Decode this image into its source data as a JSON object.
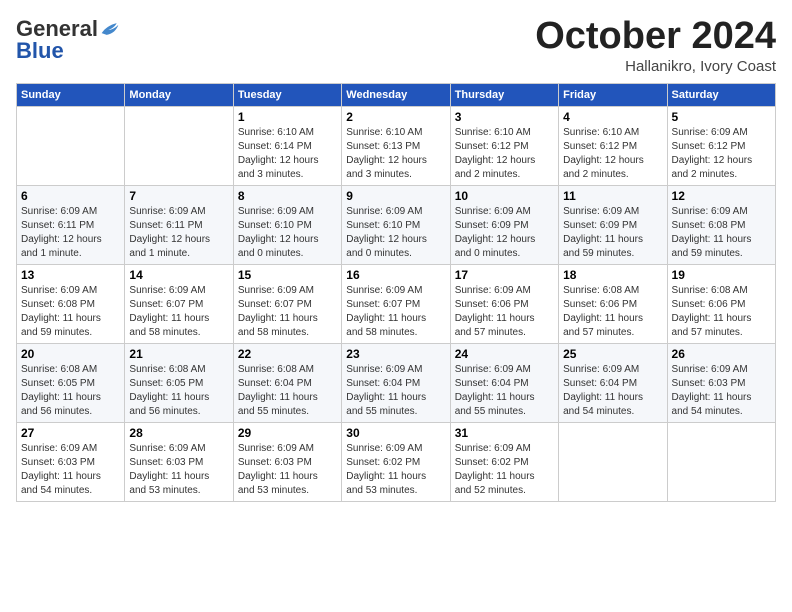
{
  "logo": {
    "general": "General",
    "blue": "Blue"
  },
  "header": {
    "month": "October 2024",
    "location": "Hallanikro, Ivory Coast"
  },
  "weekdays": [
    "Sunday",
    "Monday",
    "Tuesday",
    "Wednesday",
    "Thursday",
    "Friday",
    "Saturday"
  ],
  "weeks": [
    [
      {
        "day": "",
        "info": ""
      },
      {
        "day": "",
        "info": ""
      },
      {
        "day": "1",
        "info": "Sunrise: 6:10 AM\nSunset: 6:14 PM\nDaylight: 12 hours\nand 3 minutes."
      },
      {
        "day": "2",
        "info": "Sunrise: 6:10 AM\nSunset: 6:13 PM\nDaylight: 12 hours\nand 3 minutes."
      },
      {
        "day": "3",
        "info": "Sunrise: 6:10 AM\nSunset: 6:12 PM\nDaylight: 12 hours\nand 2 minutes."
      },
      {
        "day": "4",
        "info": "Sunrise: 6:10 AM\nSunset: 6:12 PM\nDaylight: 12 hours\nand 2 minutes."
      },
      {
        "day": "5",
        "info": "Sunrise: 6:09 AM\nSunset: 6:12 PM\nDaylight: 12 hours\nand 2 minutes."
      }
    ],
    [
      {
        "day": "6",
        "info": "Sunrise: 6:09 AM\nSunset: 6:11 PM\nDaylight: 12 hours\nand 1 minute."
      },
      {
        "day": "7",
        "info": "Sunrise: 6:09 AM\nSunset: 6:11 PM\nDaylight: 12 hours\nand 1 minute."
      },
      {
        "day": "8",
        "info": "Sunrise: 6:09 AM\nSunset: 6:10 PM\nDaylight: 12 hours\nand 0 minutes."
      },
      {
        "day": "9",
        "info": "Sunrise: 6:09 AM\nSunset: 6:10 PM\nDaylight: 12 hours\nand 0 minutes."
      },
      {
        "day": "10",
        "info": "Sunrise: 6:09 AM\nSunset: 6:09 PM\nDaylight: 12 hours\nand 0 minutes."
      },
      {
        "day": "11",
        "info": "Sunrise: 6:09 AM\nSunset: 6:09 PM\nDaylight: 11 hours\nand 59 minutes."
      },
      {
        "day": "12",
        "info": "Sunrise: 6:09 AM\nSunset: 6:08 PM\nDaylight: 11 hours\nand 59 minutes."
      }
    ],
    [
      {
        "day": "13",
        "info": "Sunrise: 6:09 AM\nSunset: 6:08 PM\nDaylight: 11 hours\nand 59 minutes."
      },
      {
        "day": "14",
        "info": "Sunrise: 6:09 AM\nSunset: 6:07 PM\nDaylight: 11 hours\nand 58 minutes."
      },
      {
        "day": "15",
        "info": "Sunrise: 6:09 AM\nSunset: 6:07 PM\nDaylight: 11 hours\nand 58 minutes."
      },
      {
        "day": "16",
        "info": "Sunrise: 6:09 AM\nSunset: 6:07 PM\nDaylight: 11 hours\nand 58 minutes."
      },
      {
        "day": "17",
        "info": "Sunrise: 6:09 AM\nSunset: 6:06 PM\nDaylight: 11 hours\nand 57 minutes."
      },
      {
        "day": "18",
        "info": "Sunrise: 6:08 AM\nSunset: 6:06 PM\nDaylight: 11 hours\nand 57 minutes."
      },
      {
        "day": "19",
        "info": "Sunrise: 6:08 AM\nSunset: 6:06 PM\nDaylight: 11 hours\nand 57 minutes."
      }
    ],
    [
      {
        "day": "20",
        "info": "Sunrise: 6:08 AM\nSunset: 6:05 PM\nDaylight: 11 hours\nand 56 minutes."
      },
      {
        "day": "21",
        "info": "Sunrise: 6:08 AM\nSunset: 6:05 PM\nDaylight: 11 hours\nand 56 minutes."
      },
      {
        "day": "22",
        "info": "Sunrise: 6:08 AM\nSunset: 6:04 PM\nDaylight: 11 hours\nand 55 minutes."
      },
      {
        "day": "23",
        "info": "Sunrise: 6:09 AM\nSunset: 6:04 PM\nDaylight: 11 hours\nand 55 minutes."
      },
      {
        "day": "24",
        "info": "Sunrise: 6:09 AM\nSunset: 6:04 PM\nDaylight: 11 hours\nand 55 minutes."
      },
      {
        "day": "25",
        "info": "Sunrise: 6:09 AM\nSunset: 6:04 PM\nDaylight: 11 hours\nand 54 minutes."
      },
      {
        "day": "26",
        "info": "Sunrise: 6:09 AM\nSunset: 6:03 PM\nDaylight: 11 hours\nand 54 minutes."
      }
    ],
    [
      {
        "day": "27",
        "info": "Sunrise: 6:09 AM\nSunset: 6:03 PM\nDaylight: 11 hours\nand 54 minutes."
      },
      {
        "day": "28",
        "info": "Sunrise: 6:09 AM\nSunset: 6:03 PM\nDaylight: 11 hours\nand 53 minutes."
      },
      {
        "day": "29",
        "info": "Sunrise: 6:09 AM\nSunset: 6:03 PM\nDaylight: 11 hours\nand 53 minutes."
      },
      {
        "day": "30",
        "info": "Sunrise: 6:09 AM\nSunset: 6:02 PM\nDaylight: 11 hours\nand 53 minutes."
      },
      {
        "day": "31",
        "info": "Sunrise: 6:09 AM\nSunset: 6:02 PM\nDaylight: 11 hours\nand 52 minutes."
      },
      {
        "day": "",
        "info": ""
      },
      {
        "day": "",
        "info": ""
      }
    ]
  ]
}
